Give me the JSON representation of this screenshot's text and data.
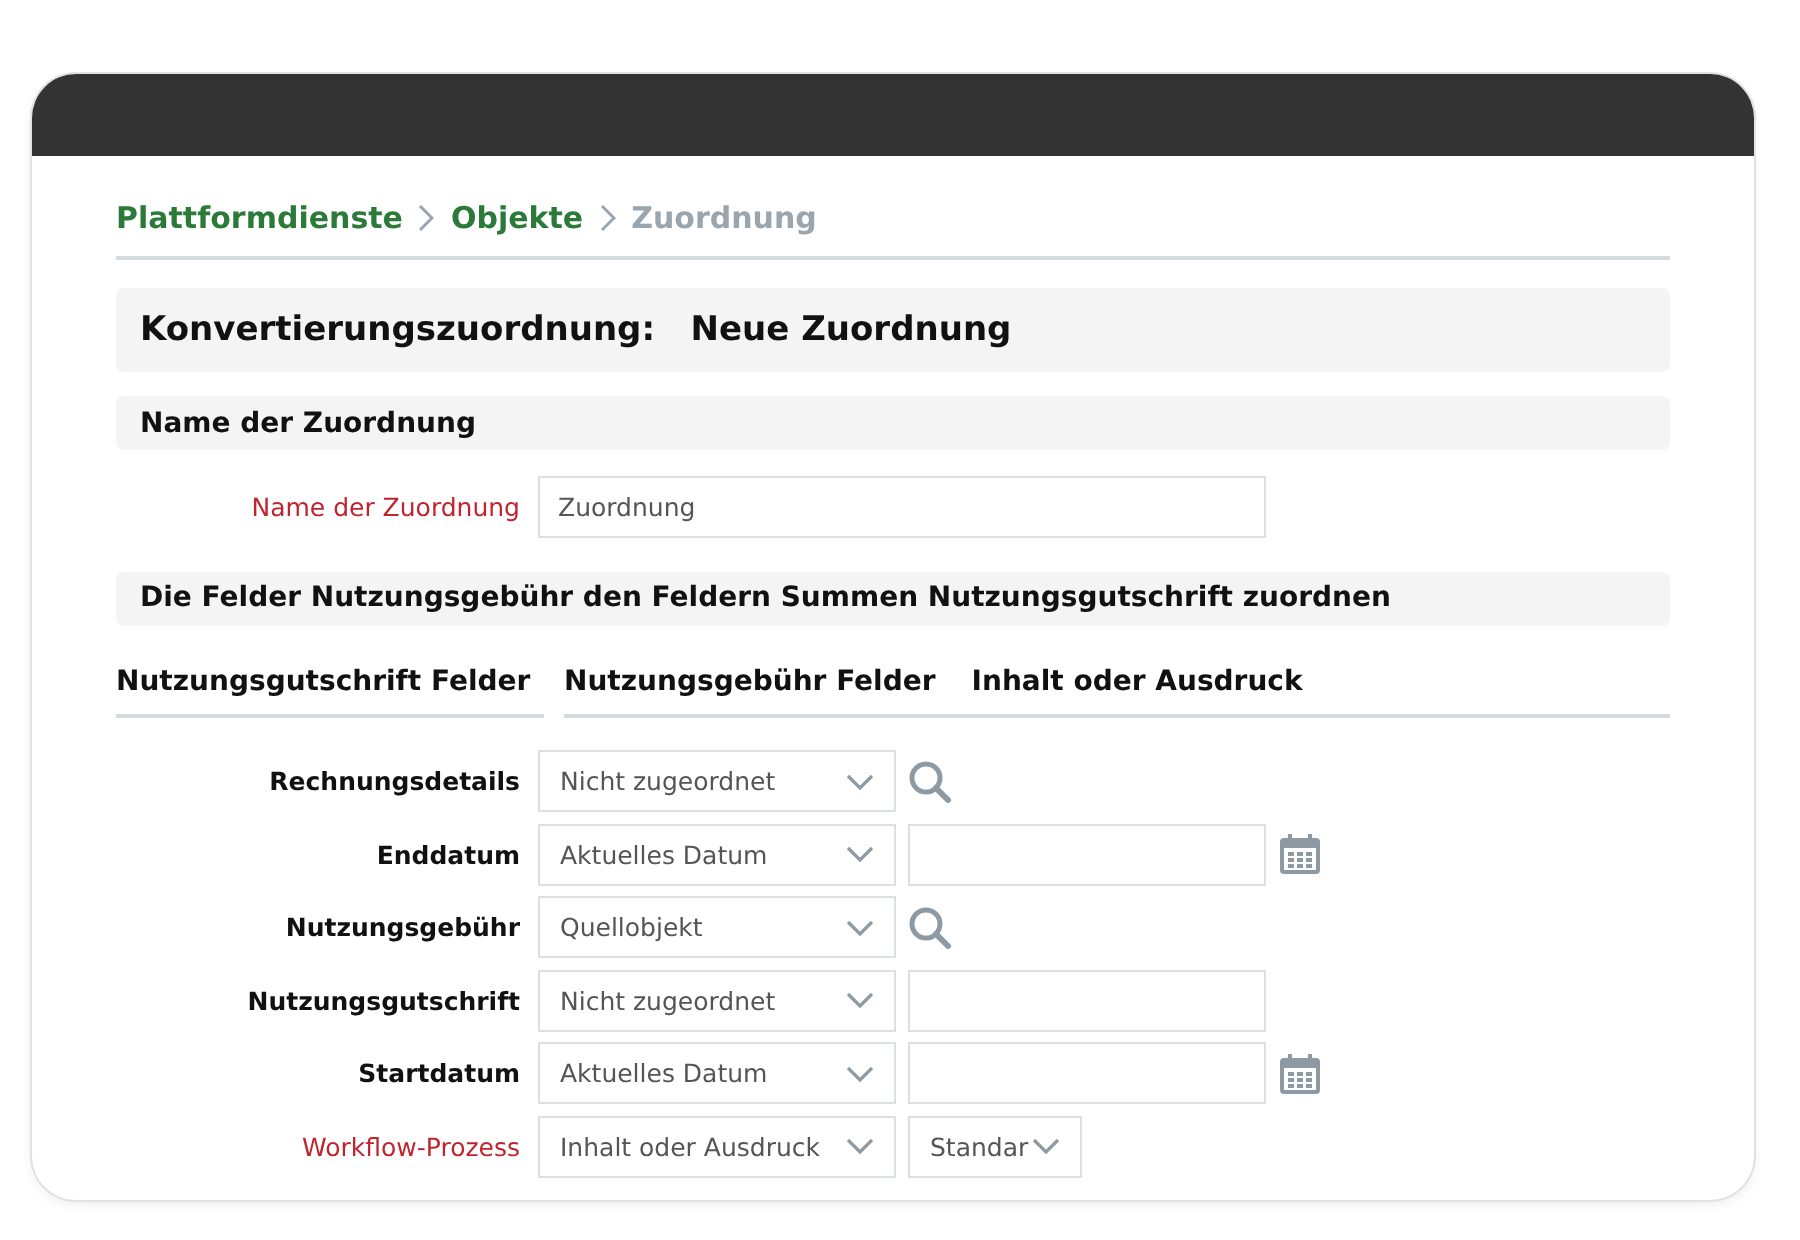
{
  "breadcrumb": [
    {
      "label": "Plattformdienste",
      "current": false
    },
    {
      "label": "Objekte",
      "current": false
    },
    {
      "label": "Zuordnung",
      "current": true
    }
  ],
  "page_title": "Konvertierungszuordnung:   Neue Zuordnung",
  "name_section": {
    "title": "Name der Zuordnung",
    "label": "Name der Zuordnung",
    "required": true,
    "value": "Zuordnung"
  },
  "mapping_section": {
    "title": "Die Felder Nutzungsgebühr den Feldern Summen Nutzungsgutschrift zuordnen",
    "columns": [
      "Nutzungsgutschrift Felder",
      "Nutzungsgebühr Felder",
      "Inhalt oder Ausdruck"
    ],
    "rows": [
      {
        "label": "Rechnungsdetails",
        "required": false,
        "select": "Nicht zugeordnet",
        "kind": "search"
      },
      {
        "label": "Enddatum",
        "required": false,
        "select": "Aktuelles Datum",
        "kind": "date"
      },
      {
        "label": "Nutzungsgebühr",
        "required": false,
        "select": "Quellobjekt",
        "kind": "search"
      },
      {
        "label": "Nutzungsgutschrift",
        "required": false,
        "select": "Nicht zugeordnet",
        "kind": "text"
      },
      {
        "label": "Startdatum",
        "required": false,
        "select": "Aktuelles Datum",
        "kind": "date"
      },
      {
        "label": "Workflow-Prozess",
        "required": true,
        "select": "Inhalt oder Ausdruck",
        "kind": "select",
        "value": "Standar"
      }
    ]
  }
}
